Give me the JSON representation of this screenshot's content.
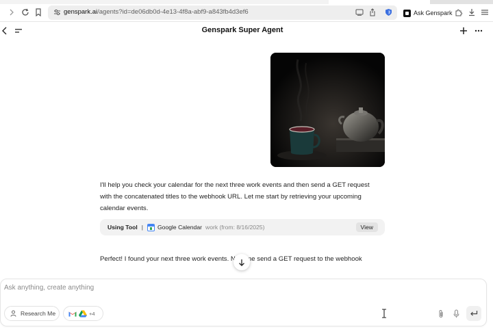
{
  "browser": {
    "url_host": "genspark.ai",
    "url_path": "/agents?id=de06db0d-4e13-4f8a-abf9-a843fb4d3ef6",
    "ask_label": "Ask Genspark"
  },
  "header": {
    "title": "Genspark Super Agent"
  },
  "chat": {
    "assistant_message": "I'll help you check your calendar for the next three work events and then send a GET request with the concatenated titles to the webhook URL. Let me start by retrieving your upcoming calendar events.",
    "tool_call": {
      "label": "Using Tool",
      "separator": "|",
      "tool_name": "Google Calendar",
      "params": "work (from: 8/16/2025)",
      "view_label": "View"
    },
    "followup_message": "Perfect! I found your next three work events. N     let me send a GET request to the webhook"
  },
  "composer": {
    "placeholder": "Ask anything, create anything",
    "research_label": "Research Me",
    "integrations_more": "+4"
  },
  "colors": {
    "accent_blue": "#4285f4",
    "chip_border": "#e2e2e2",
    "tool_bg": "#f2f2f2"
  }
}
